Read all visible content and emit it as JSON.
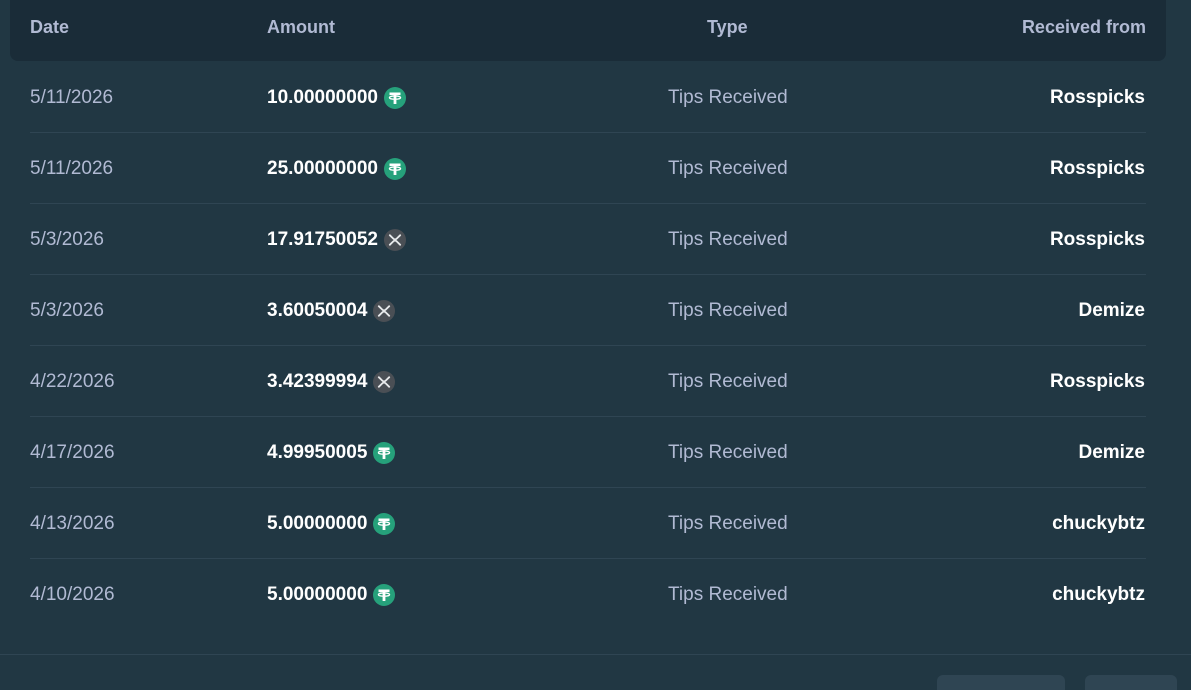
{
  "header": {
    "date": "Date",
    "amount": "Amount",
    "type": "Type",
    "received_from": "Received from"
  },
  "rows": [
    {
      "date": "5/11/2026",
      "amount": "10.00000000",
      "currency_icon": "usdt-icon",
      "type": "Tips Received",
      "from": "Rosspicks"
    },
    {
      "date": "5/11/2026",
      "amount": "25.00000000",
      "currency_icon": "usdt-icon",
      "type": "Tips Received",
      "from": "Rosspicks"
    },
    {
      "date": "5/3/2026",
      "amount": "17.91750052",
      "currency_icon": "xrp-icon",
      "type": "Tips Received",
      "from": "Rosspicks"
    },
    {
      "date": "5/3/2026",
      "amount": "3.60050004",
      "currency_icon": "xrp-icon",
      "type": "Tips Received",
      "from": "Demize"
    },
    {
      "date": "4/22/2026",
      "amount": "3.42399994",
      "currency_icon": "xrp-icon",
      "type": "Tips Received",
      "from": "Rosspicks"
    },
    {
      "date": "4/17/2026",
      "amount": "4.99950005",
      "currency_icon": "usdt-icon",
      "type": "Tips Received",
      "from": "Demize"
    },
    {
      "date": "4/13/2026",
      "amount": "5.00000000",
      "currency_icon": "usdt-icon",
      "type": "Tips Received",
      "from": "chuckybtz"
    },
    {
      "date": "4/10/2026",
      "amount": "5.00000000",
      "currency_icon": "usdt-icon",
      "type": "Tips Received",
      "from": "chuckybtz"
    }
  ],
  "colors": {
    "usdt": "#26a17b",
    "xrp": "#4a4f55"
  }
}
